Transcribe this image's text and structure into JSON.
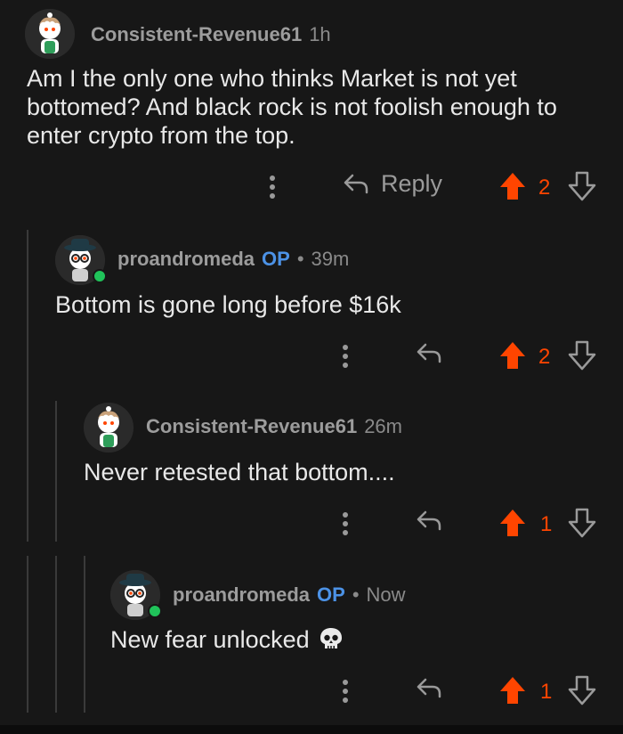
{
  "colors": {
    "background": "#171717",
    "upvote": "#ff4500",
    "op_badge": "#4c92e6",
    "online": "#20c35a"
  },
  "comments": [
    {
      "username": "Consistent-Revenue61",
      "time": "1h",
      "body": "Am I the only one who thinks Market is not yet bottomed? And black rock is not foolish enough to enter crypto from the top.",
      "reply_label": "Reply",
      "score": "2",
      "avatar": "snoo-curly-hair-green-apron"
    },
    {
      "username": "proandromeda",
      "op": "OP",
      "separator": "•",
      "time": "39m",
      "body": "Bottom is gone long before $16k",
      "score": "2",
      "avatar": "snoo-hat-glasses"
    },
    {
      "username": "Consistent-Revenue61",
      "time": "26m",
      "body": "Never retested that bottom....",
      "score": "1",
      "avatar": "snoo-curly-hair-green-apron"
    },
    {
      "username": "proandromeda",
      "op": "OP",
      "separator": "•",
      "time": "Now",
      "body": "New fear unlocked",
      "score": "1",
      "avatar": "snoo-hat-glasses",
      "emoji": "skull-icon"
    }
  ]
}
